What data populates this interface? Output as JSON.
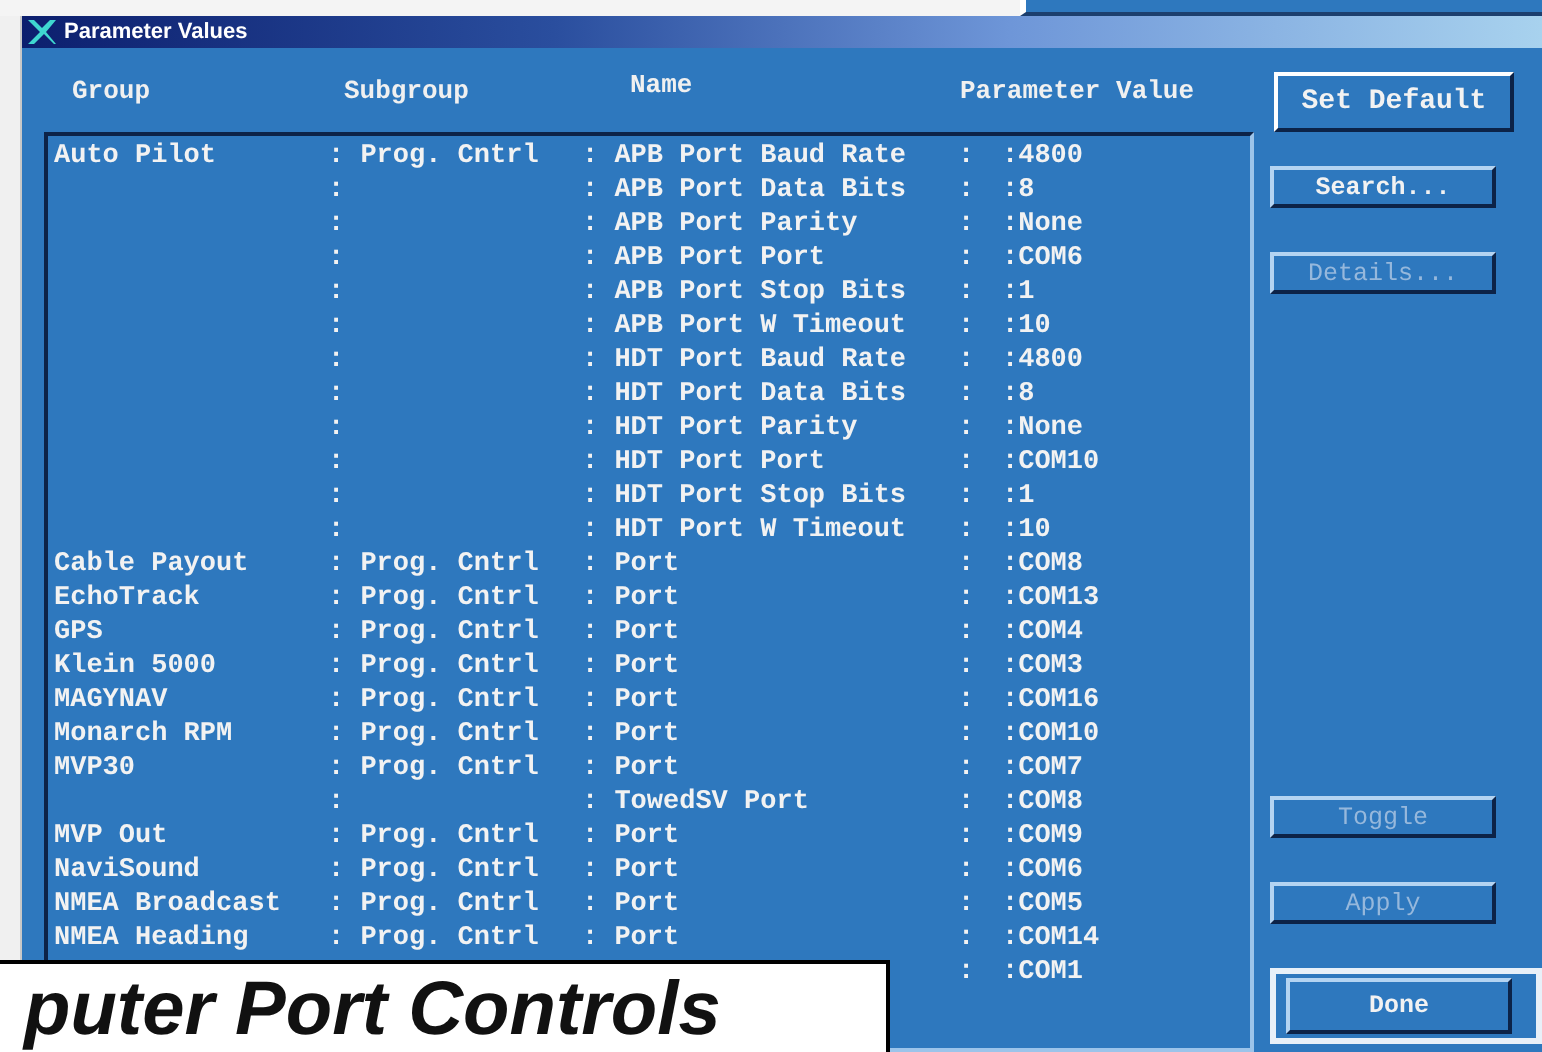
{
  "window": {
    "title": "Parameter Values"
  },
  "columns": [
    "Group",
    "Subgroup",
    "Name",
    "Parameter Value"
  ],
  "rows": [
    {
      "group": "Auto Pilot",
      "subgroup": ": Prog. Cntrl",
      "name": ": APB Port Baud Rate",
      "separator": ":",
      "value": ":4800"
    },
    {
      "subgroup": ":",
      "name": ": APB Port Data Bits",
      "separator": ":",
      "value": ":8"
    },
    {
      "subgroup": ":",
      "name": ": APB Port Parity",
      "separator": ":",
      "value": ":None"
    },
    {
      "subgroup": ":",
      "name": ": APB Port Port",
      "separator": ":",
      "value": ":COM6"
    },
    {
      "subgroup": ":",
      "name": ": APB Port Stop Bits",
      "separator": ":",
      "value": ":1"
    },
    {
      "subgroup": ":",
      "name": ": APB Port W Timeout",
      "separator": ":",
      "value": ":10"
    },
    {
      "subgroup": ":",
      "name": ": HDT Port Baud Rate",
      "separator": ":",
      "value": ":4800"
    },
    {
      "subgroup": ":",
      "name": ": HDT Port Data Bits",
      "separator": ":",
      "value": ":8"
    },
    {
      "subgroup": ":",
      "name": ": HDT Port Parity",
      "separator": ":",
      "value": ":None"
    },
    {
      "subgroup": ":",
      "name": ": HDT Port Port",
      "separator": ":",
      "value": ":COM10"
    },
    {
      "subgroup": ":",
      "name": ": HDT Port Stop Bits",
      "separator": ":",
      "value": ":1"
    },
    {
      "subgroup": ":",
      "name": ": HDT Port W Timeout",
      "separator": ":",
      "value": ":10"
    },
    {
      "group": "Cable Payout",
      "subgroup": ": Prog. Cntrl",
      "name": ": Port",
      "separator": ":",
      "value": ":COM8"
    },
    {
      "group": "EchoTrack",
      "subgroup": ": Prog. Cntrl",
      "name": ": Port",
      "separator": ":",
      "value": ":COM13"
    },
    {
      "group": "GPS",
      "subgroup": ": Prog. Cntrl",
      "name": ": Port",
      "separator": ":",
      "value": ":COM4"
    },
    {
      "group": "Klein 5000",
      "subgroup": ": Prog. Cntrl",
      "name": ": Port",
      "separator": ":",
      "value": ":COM3"
    },
    {
      "group": "MAGYNAV",
      "subgroup": ": Prog. Cntrl",
      "name": ": Port",
      "separator": ":",
      "value": ":COM16"
    },
    {
      "group": "Monarch RPM",
      "subgroup": ": Prog. Cntrl",
      "name": ": Port",
      "separator": ":",
      "value": ":COM10"
    },
    {
      "group": "MVP30",
      "subgroup": ": Prog. Cntrl",
      "name": ": Port",
      "separator": ":",
      "value": ":COM7"
    },
    {
      "subgroup": ":",
      "name": ": TowedSV Port",
      "separator": ":",
      "value": ":COM8"
    },
    {
      "group": "MVP Out",
      "subgroup": ": Prog. Cntrl",
      "name": ": Port",
      "separator": ":",
      "value": ":COM9"
    },
    {
      "group": "NaviSound",
      "subgroup": ": Prog. Cntrl",
      "name": ": Port",
      "separator": ":",
      "value": ":COM6"
    },
    {
      "group": "NMEA Broadcast",
      "subgroup": ": Prog. Cntrl",
      "name": ": Port",
      "separator": ":",
      "value": ":COM5"
    },
    {
      "group": "NMEA Heading",
      "subgroup": ": Prog. Cntrl",
      "name": ": Port",
      "separator": ":",
      "value": ":COM14"
    },
    {
      "separator": ":",
      "value": ":COM1"
    }
  ],
  "buttons": [
    {
      "label": "Set Default",
      "kind": "top",
      "disabled": false,
      "focused": false
    },
    {
      "label": "Search...",
      "kind": "top",
      "disabled": false,
      "focused": false
    },
    {
      "label": "Details...",
      "kind": "top",
      "disabled": true,
      "focused": false
    },
    {
      "label": "Toggle",
      "kind": "bottom",
      "disabled": true,
      "focused": false
    },
    {
      "label": "Apply",
      "kind": "bottom",
      "disabled": true,
      "focused": false
    },
    {
      "label": "Done",
      "kind": "bottom",
      "disabled": false,
      "focused": true
    }
  ],
  "caption": {
    "text": "puter Port Controls"
  }
}
